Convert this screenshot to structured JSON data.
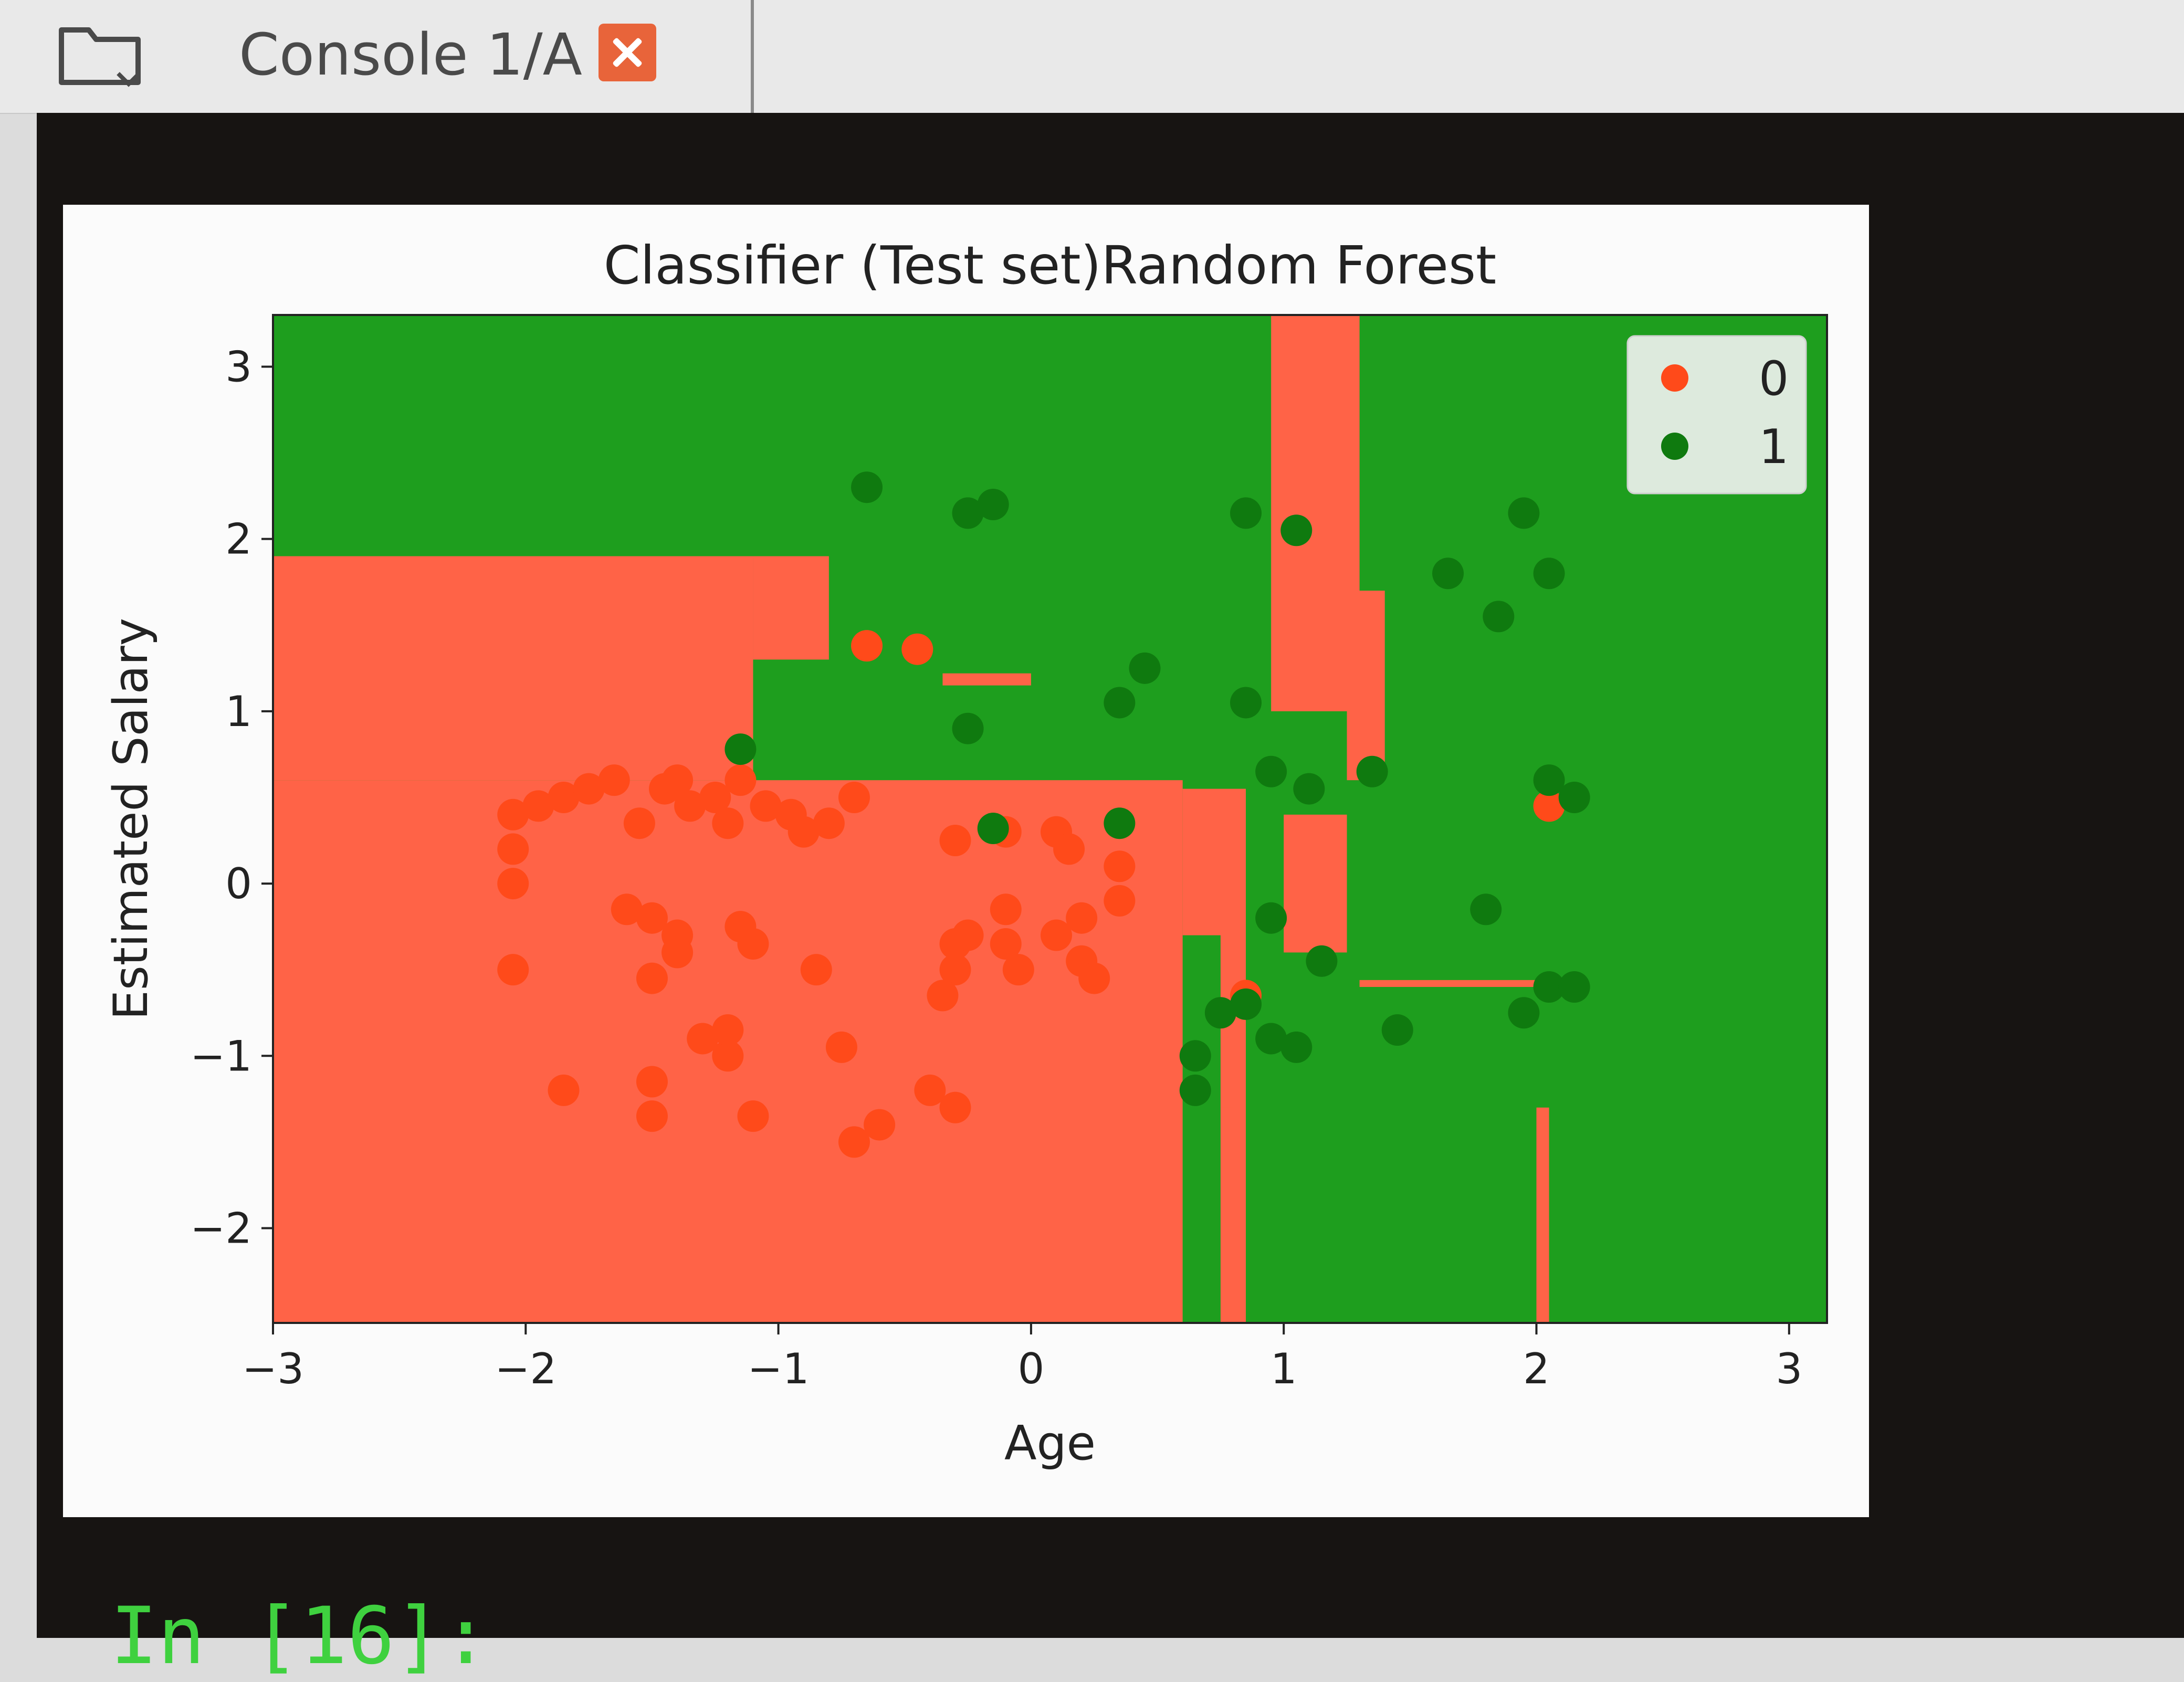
{
  "tab": {
    "icon": "folder-icon",
    "label": "Console 1/A",
    "close_icon": "close-icon",
    "close_color": "#e8643a"
  },
  "console": {
    "prompt_text": "In [16]:"
  },
  "colors": {
    "class0": "#ff6347",
    "class1": "#1e9e1e",
    "point0": "#ff4a1a",
    "point1": "#0f7a0f"
  },
  "chart_data": {
    "type": "scatter",
    "title": "Classifier (Test set)Random Forest",
    "xlabel": "Age",
    "ylabel": "Estimated Salary",
    "xlim": [
      -3,
      3.15
    ],
    "ylim": [
      -2.55,
      3.3
    ],
    "xticks": [
      -3,
      -2,
      -1,
      0,
      1,
      2,
      3
    ],
    "yticks": [
      -2,
      -1,
      0,
      1,
      2,
      3
    ],
    "xticklabels": [
      "−3",
      "−2",
      "−1",
      "0",
      "1",
      "2",
      "3"
    ],
    "yticklabels": [
      "−2",
      "−1",
      "0",
      "1",
      "2",
      "3"
    ],
    "legend_position": "top-right",
    "background": "decision regions",
    "series": [
      {
        "name": "0",
        "color": "#ff4a1a",
        "points": [
          [
            -0.65,
            1.38
          ],
          [
            -0.45,
            1.36
          ],
          [
            -2.05,
            0.4
          ],
          [
            -1.95,
            0.45
          ],
          [
            -1.85,
            0.5
          ],
          [
            -1.75,
            0.55
          ],
          [
            -1.65,
            0.6
          ],
          [
            -1.55,
            0.35
          ],
          [
            -1.45,
            0.55
          ],
          [
            -1.35,
            0.45
          ],
          [
            -1.25,
            0.5
          ],
          [
            -1.15,
            0.6
          ],
          [
            -1.05,
            0.45
          ],
          [
            -0.95,
            0.4
          ],
          [
            -0.9,
            0.3
          ],
          [
            -0.8,
            0.35
          ],
          [
            -0.7,
            0.5
          ],
          [
            -1.2,
            0.35
          ],
          [
            -1.4,
            0.6
          ],
          [
            -2.05,
            0.2
          ],
          [
            -2.05,
            0.0
          ],
          [
            -2.05,
            -0.5
          ],
          [
            -1.6,
            -0.15
          ],
          [
            -1.5,
            -0.2
          ],
          [
            -1.4,
            -0.3
          ],
          [
            -1.4,
            -0.4
          ],
          [
            -1.15,
            -0.25
          ],
          [
            -1.1,
            -0.35
          ],
          [
            -0.85,
            -0.5
          ],
          [
            -1.5,
            -0.55
          ],
          [
            -0.3,
            -0.35
          ],
          [
            -0.3,
            -0.5
          ],
          [
            -0.35,
            -0.65
          ],
          [
            -1.3,
            -0.9
          ],
          [
            -1.2,
            -1.0
          ],
          [
            -1.2,
            -0.85
          ],
          [
            -0.75,
            -0.95
          ],
          [
            -1.85,
            -1.2
          ],
          [
            -1.5,
            -1.15
          ],
          [
            -1.5,
            -1.35
          ],
          [
            -1.1,
            -1.35
          ],
          [
            -0.6,
            -1.4
          ],
          [
            -0.7,
            -1.5
          ],
          [
            -0.4,
            -1.2
          ],
          [
            -0.3,
            -1.3
          ],
          [
            -0.3,
            0.25
          ],
          [
            -0.1,
            0.3
          ],
          [
            0.1,
            0.3
          ],
          [
            0.15,
            0.2
          ],
          [
            -0.1,
            -0.15
          ],
          [
            -0.1,
            -0.35
          ],
          [
            -0.05,
            -0.5
          ],
          [
            0.2,
            -0.45
          ],
          [
            0.25,
            -0.55
          ],
          [
            0.35,
            0.1
          ],
          [
            0.35,
            -0.1
          ],
          [
            0.2,
            -0.2
          ],
          [
            0.1,
            -0.3
          ],
          [
            -0.25,
            -0.3
          ],
          [
            0.85,
            -0.65
          ],
          [
            2.05,
            0.45
          ]
        ]
      },
      {
        "name": "1",
        "color": "#0f7a0f",
        "points": [
          [
            -0.65,
            2.3
          ],
          [
            -0.25,
            2.15
          ],
          [
            -0.15,
            2.2
          ],
          [
            -1.15,
            0.78
          ],
          [
            -0.25,
            0.9
          ],
          [
            -0.15,
            0.32
          ],
          [
            0.35,
            0.35
          ],
          [
            0.35,
            1.05
          ],
          [
            0.45,
            1.25
          ],
          [
            0.85,
            1.05
          ],
          [
            0.85,
            2.15
          ],
          [
            1.05,
            2.05
          ],
          [
            1.65,
            1.8
          ],
          [
            1.85,
            1.55
          ],
          [
            1.95,
            2.15
          ],
          [
            2.05,
            1.8
          ],
          [
            0.95,
            0.65
          ],
          [
            1.1,
            0.55
          ],
          [
            1.35,
            0.65
          ],
          [
            2.05,
            0.6
          ],
          [
            2.15,
            0.5
          ],
          [
            0.95,
            -0.2
          ],
          [
            1.15,
            -0.45
          ],
          [
            1.8,
            -0.15
          ],
          [
            0.75,
            -0.75
          ],
          [
            0.85,
            -0.7
          ],
          [
            0.95,
            -0.9
          ],
          [
            1.05,
            -0.95
          ],
          [
            1.45,
            -0.85
          ],
          [
            0.65,
            -1.0
          ],
          [
            0.65,
            -1.2
          ],
          [
            2.05,
            -0.6
          ],
          [
            2.15,
            -0.6
          ],
          [
            1.95,
            -0.75
          ]
        ]
      }
    ]
  }
}
